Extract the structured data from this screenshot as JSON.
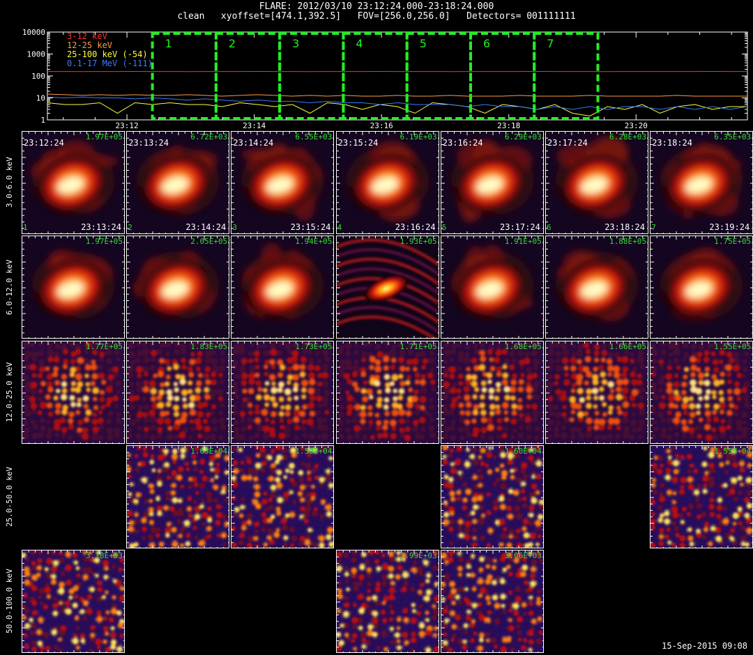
{
  "header": {
    "line1": "FLARE: 2012/03/10 23:12:24.000-23:18:24.000",
    "line2": "clean   xyoffset=[474.1,392.5]   FOV=[256.0,256.0]   Detectors= 001111111"
  },
  "footer": {
    "timestamp": "15-Sep-2015 09:08"
  },
  "chart_data": [
    {
      "type": "line",
      "yscale": "log",
      "ylim": [
        1,
        10000
      ],
      "xlim": [
        "23:10:45",
        "23:21:45"
      ],
      "yticks": [
        "1",
        "10",
        "100",
        "1000",
        "10000"
      ],
      "xticks": [
        "23:12",
        "23:14",
        "23:16",
        "23:18",
        "23:20"
      ],
      "legend_position": "top-left",
      "series": [
        {
          "name": "3-12 keV",
          "color": "#ff3030",
          "values": [
            160,
            160,
            159,
            160,
            160,
            161,
            160,
            160,
            159,
            160,
            160,
            160,
            161,
            160,
            160,
            159,
            160,
            160,
            160,
            161,
            160,
            160,
            160,
            159,
            160,
            160,
            160,
            160,
            161,
            160,
            160,
            160,
            159,
            160,
            160,
            160,
            160,
            160,
            161,
            160,
            160
          ]
        },
        {
          "name": "12-25 keV",
          "color": "#ff9a40",
          "values": [
            15,
            14,
            13,
            14,
            13,
            14,
            13,
            13,
            14,
            13,
            12,
            13,
            14,
            13,
            12,
            13,
            12,
            13,
            12,
            12,
            13,
            12,
            12,
            13,
            12,
            12,
            12,
            13,
            12,
            12,
            12,
            13,
            12,
            12,
            12,
            12,
            13,
            12,
            12,
            12,
            12
          ]
        },
        {
          "name": "25-100 keV (-54)",
          "color": "#ffff40",
          "values": [
            6,
            5,
            5,
            6,
            2,
            6,
            5,
            6,
            5,
            5,
            4,
            6,
            5,
            4,
            5,
            2,
            6,
            5,
            3,
            5,
            4,
            2,
            6,
            5,
            4,
            2,
            5,
            4,
            3,
            5,
            2,
            1.5,
            4,
            3,
            5,
            2,
            4,
            5,
            3,
            4,
            4
          ]
        },
        {
          "name": "0.1-17 MeV (-111)",
          "color": "#3a7bff",
          "values": [
            11,
            10,
            11,
            10,
            10,
            9,
            10,
            9,
            8,
            9,
            8,
            7,
            8,
            7,
            7,
            6,
            7,
            6,
            6,
            5,
            6,
            5,
            5,
            5,
            4,
            5,
            4,
            4,
            3,
            4,
            3,
            4,
            3,
            4,
            4,
            3,
            4,
            3,
            4,
            3,
            4
          ]
        }
      ],
      "intervals": [
        {
          "label": "1",
          "start": "23:12:24",
          "end": "23:13:24"
        },
        {
          "label": "2",
          "start": "23:13:24",
          "end": "23:14:24"
        },
        {
          "label": "3",
          "start": "23:14:24",
          "end": "23:15:24"
        },
        {
          "label": "4",
          "start": "23:15:24",
          "end": "23:16:24"
        },
        {
          "label": "5",
          "start": "23:16:24",
          "end": "23:17:24"
        },
        {
          "label": "6",
          "start": "23:17:24",
          "end": "23:18:24"
        },
        {
          "label": "7",
          "start": "23:18:24",
          "end": "23:19:24"
        }
      ],
      "interval_color": "#22ee22"
    },
    {
      "type": "heatmap",
      "energy_bands": [
        "3.0-6.0 keV",
        "6.0-12.0 keV",
        "12.0-25.0 keV",
        "25.0-50.0 keV",
        "50.0-100.0 keV"
      ],
      "time_starts": [
        "23:12:24",
        "23:13:24",
        "23:14:24",
        "23:15:24",
        "23:16:24",
        "23:17:24",
        "23:18:24"
      ],
      "time_ends": [
        "23:13:24",
        "23:14:24",
        "23:15:24",
        "23:16:24",
        "23:17:24",
        "23:18:24",
        "23:19:24"
      ],
      "interval_numbers": [
        "1",
        "2",
        "3",
        "4",
        "5",
        "6",
        "7"
      ],
      "peak_flux": [
        [
          "1.97E+05",
          "6.72E+03",
          "6.55E+03",
          "6.19E+03",
          "6.29E+03",
          "6.28E+03",
          "6.35E+03"
        ],
        [
          "1.97E+05",
          "2.05E+05",
          "1.94E+05",
          "1.93E+05",
          "1.91E+05",
          "1.88E+05",
          "1.75E+05"
        ],
        [
          "1.77E+05",
          "1.83E+05",
          "1.73E+05",
          "1.71E+05",
          "1.68E+05",
          "1.66E+05",
          "1.55E+05"
        ],
        [
          "",
          "1.63E+04",
          "1.59E+04",
          "",
          "1.60E+04",
          "",
          "1.55E+04"
        ],
        [
          "3.18E+03",
          "",
          "",
          "2.99E+03",
          "3.06E+03",
          "",
          ""
        ]
      ],
      "panel_kind": [
        [
          "smooth",
          "smooth",
          "smooth",
          "smooth",
          "smooth",
          "smooth",
          "smooth"
        ],
        [
          "smooth",
          "smooth",
          "smooth",
          "fringe",
          "smooth",
          "smooth",
          "smooth"
        ],
        [
          "mottled",
          "mottled",
          "mottled",
          "mottled",
          "mottled",
          "mottled",
          "mottled"
        ],
        [
          "empty",
          "noise",
          "noise",
          "empty",
          "noise",
          "empty",
          "noise"
        ],
        [
          "noise",
          "empty",
          "empty",
          "noise",
          "noise",
          "empty",
          "empty"
        ]
      ],
      "colormap": "hot"
    }
  ]
}
